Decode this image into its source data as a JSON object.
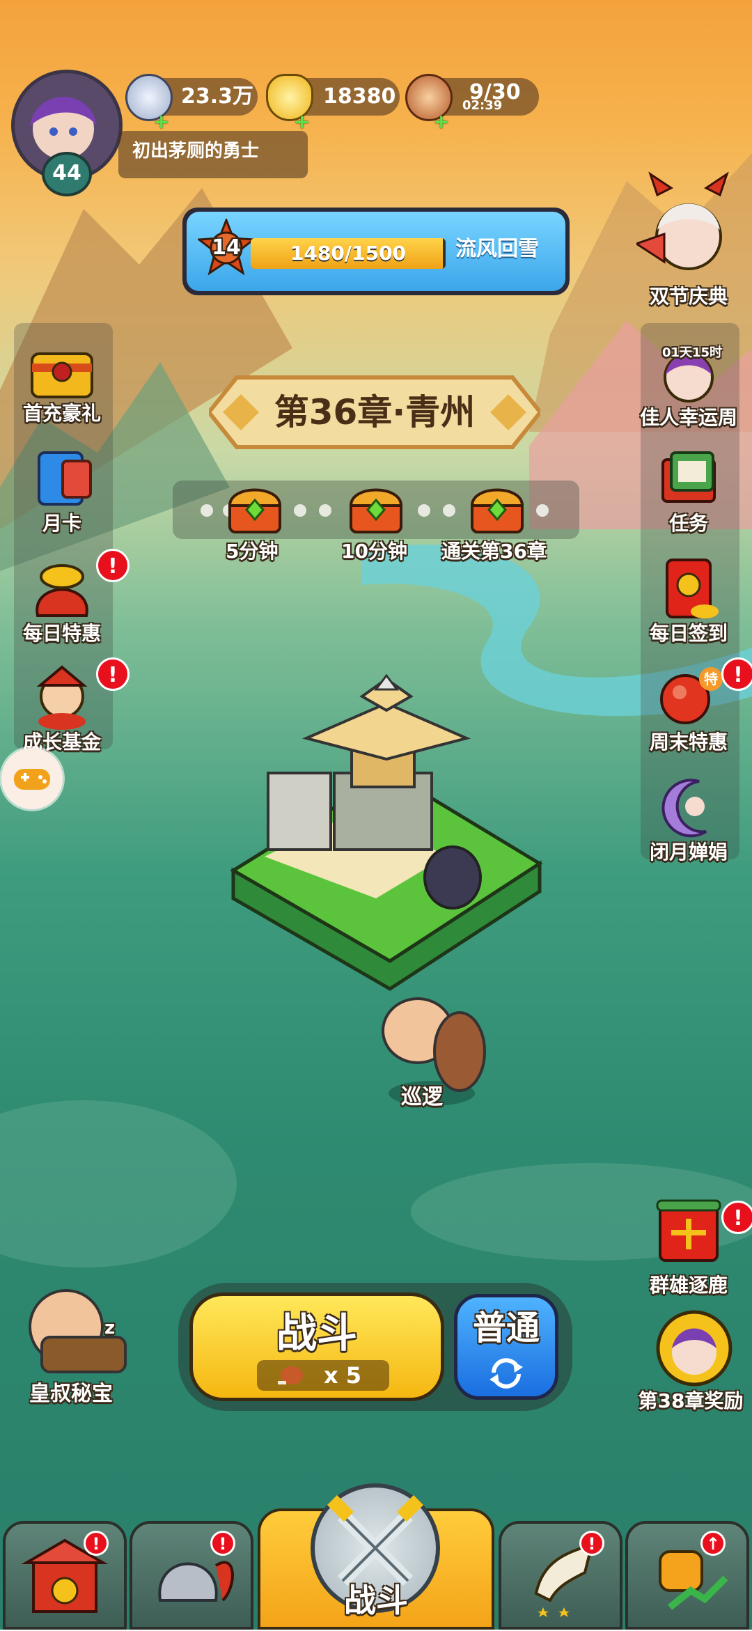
{
  "player": {
    "level": "44",
    "title": "初出茅厕的勇士"
  },
  "resources": [
    {
      "name": "silver-coin-icon",
      "value": "23.3万"
    },
    {
      "name": "gold-ingot-icon",
      "value": "18380"
    },
    {
      "name": "meat-stamina-icon",
      "value": "9/30",
      "timer": "02:39"
    }
  ],
  "progress": {
    "badge_level": "14",
    "text": "1480/1500",
    "fraction": 0.987,
    "label": "流风回雪"
  },
  "chapter": {
    "title": "第36章·青州"
  },
  "rewards": [
    {
      "label": "5分钟"
    },
    {
      "label": "10分钟"
    },
    {
      "label": "通关第36章"
    }
  ],
  "left_menu": [
    {
      "label": "首充豪礼",
      "alert": false
    },
    {
      "label": "月卡",
      "alert": false
    },
    {
      "label": "每日特惠",
      "alert": true
    },
    {
      "label": "成长基金",
      "alert": true
    }
  ],
  "right_menu": [
    {
      "label": "双节庆典",
      "alert": false
    },
    {
      "label": "佳人幸运周",
      "timer": "01天15时",
      "alert": false
    },
    {
      "label": "任务",
      "alert": false
    },
    {
      "label": "每日签到",
      "alert": false
    },
    {
      "label": "周末特惠",
      "alert": true,
      "tag": "特"
    },
    {
      "label": "闭月婵娟",
      "alert": false
    },
    {
      "label": "群雄逐鹿",
      "alert": true
    },
    {
      "label": "第38章奖励",
      "alert": false
    }
  ],
  "scene": {
    "patrol_label": "巡逻",
    "treasure_label": "皇叔秘宝",
    "sleep_mark": "z"
  },
  "battle": {
    "label": "战斗",
    "cost": "x 5",
    "mode": "普通"
  },
  "tabbar": {
    "active_label": "战斗",
    "alert_mark": "!"
  },
  "alert_mark": "!"
}
